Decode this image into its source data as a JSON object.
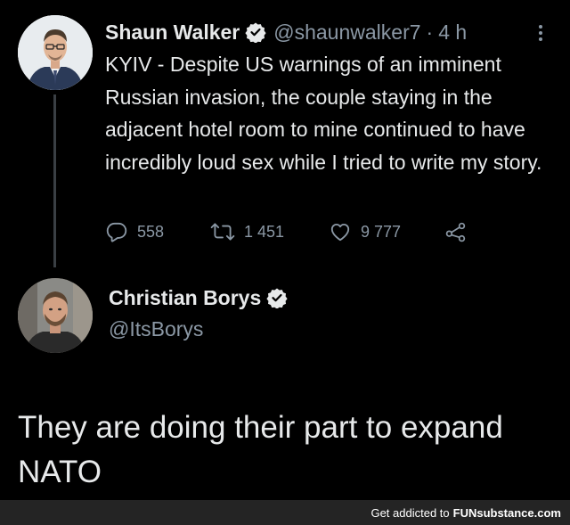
{
  "tweet1": {
    "name": "Shaun Walker",
    "handle": "@shaunwalker7",
    "separator": "·",
    "time": "4 h",
    "body": "KYIV - Despite US warnings of an imminent Russian invasion, the couple staying in the adjacent hotel room to mine continued to have incredibly loud sex while I tried to write my story.",
    "replies": "558",
    "retweets": "1 451",
    "likes": "9 777"
  },
  "tweet2": {
    "name": "Christian Borys",
    "handle": "@ItsBorys",
    "body": "They are doing their part to expand NATO"
  },
  "footer": {
    "prefix": "Get addicted to",
    "brand_bold": "FUN",
    "brand_rest": "substance.com"
  },
  "colors": {
    "background": "#000000",
    "text": "#e7e9ea",
    "muted": "#8b98a5",
    "verified_badge": "#e7e9ea",
    "footer_bg": "#242424"
  },
  "icons": [
    "verified-badge-icon",
    "more-options-icon",
    "reply-icon",
    "retweet-icon",
    "like-icon",
    "share-icon"
  ]
}
